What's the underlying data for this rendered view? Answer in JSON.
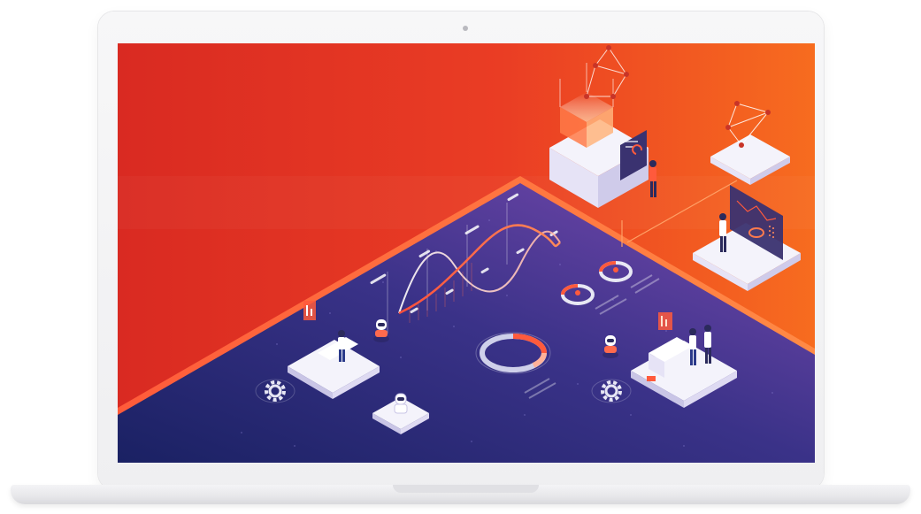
{
  "scene": {
    "description_icons": [
      "laptop-icon",
      "camera-icon",
      "gear-icon",
      "robot-icon",
      "person-icon",
      "network-icon",
      "donut-chart-icon",
      "line-chart-icon"
    ],
    "colors": {
      "bg_red": "#e22a22",
      "bg_orange": "#f56a20",
      "panel_navy": "#1f2a6b",
      "panel_purple": "#6b45a8",
      "accent_coral": "#ff6a4d",
      "platform_white": "#f4f3fb",
      "laptop_silver": "#f1f1f3"
    }
  }
}
